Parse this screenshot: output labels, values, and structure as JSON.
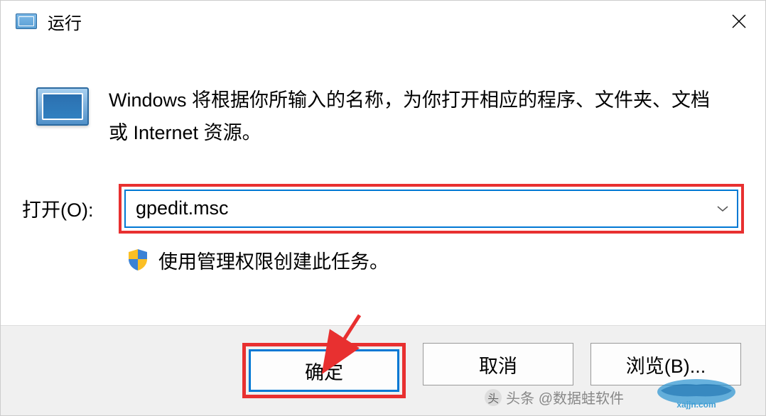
{
  "titlebar": {
    "title": "运行"
  },
  "content": {
    "description": "Windows 将根据你所输入的名称，为你打开相应的程序、文件夹、文档或 Internet 资源。",
    "open_label": "打开(O):",
    "input_value": "gpedit.msc",
    "admin_text": "使用管理权限创建此任务。"
  },
  "buttons": {
    "ok": "确定",
    "cancel": "取消",
    "browse": "浏览(B)..."
  },
  "watermark": {
    "headline": "头条 @数据蛙软件",
    "url": "xajjn.com"
  }
}
